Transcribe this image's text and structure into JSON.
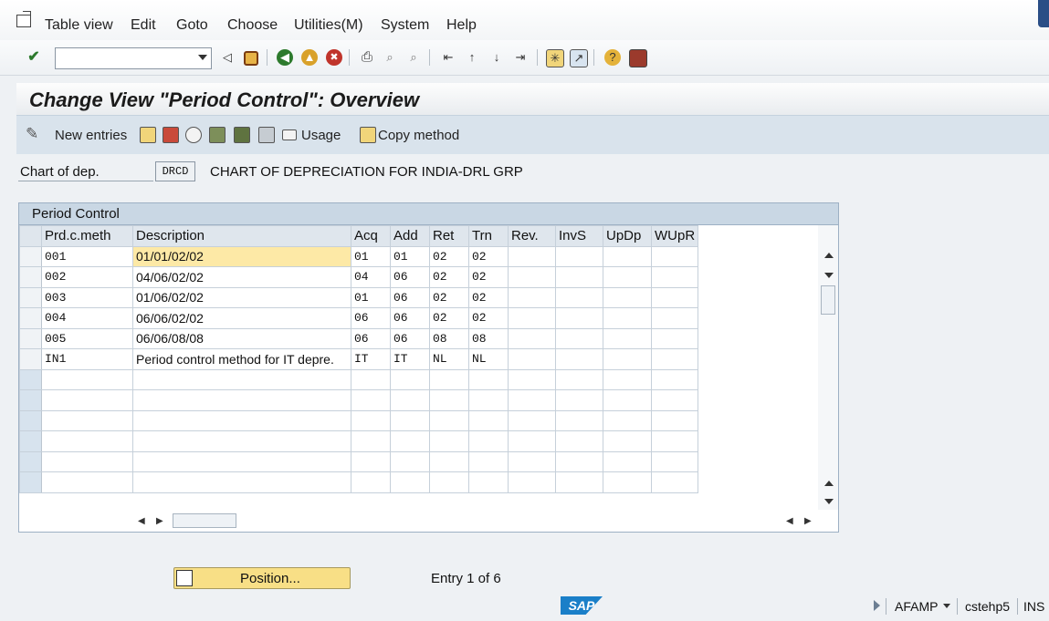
{
  "menu": {
    "items": [
      "Table view",
      "Edit",
      "Goto",
      "Choose",
      "Utilities(M)",
      "System",
      "Help"
    ]
  },
  "toolbar": {
    "icons": [
      "enter-icon",
      "back-icon",
      "save-icon",
      "back-green-icon",
      "exit-icon",
      "cancel-icon",
      "print-icon",
      "find-icon",
      "find-next-icon",
      "first-page-icon",
      "prev-page-icon",
      "next-page-icon",
      "last-page-icon",
      "create-session-icon",
      "shortcut-icon",
      "help-icon",
      "layout-icon"
    ]
  },
  "header": {
    "title": "Change View \"Period Control\": Overview"
  },
  "appbar": {
    "new_entries": "New entries",
    "usage": "Usage",
    "copy_method": "Copy method"
  },
  "chart": {
    "label": "Chart of dep.",
    "code": "DRCD",
    "description": "CHART OF DEPRECIATION FOR INDIA-DRL GRP"
  },
  "table": {
    "title": "Period Control",
    "columns": [
      "Prd.c.meth",
      "Description",
      "Acq",
      "Add",
      "Ret",
      "Trn",
      "Rev.",
      "InvS",
      "UpDp",
      "WUpR"
    ],
    "rows": [
      [
        "001",
        "01/01/02/02",
        "01",
        "01",
        "02",
        "02",
        "",
        "",
        "",
        ""
      ],
      [
        "002",
        "04/06/02/02",
        "04",
        "06",
        "02",
        "02",
        "",
        "",
        "",
        ""
      ],
      [
        "003",
        "01/06/02/02",
        "01",
        "06",
        "02",
        "02",
        "",
        "",
        "",
        ""
      ],
      [
        "004",
        "06/06/02/02",
        "06",
        "06",
        "02",
        "02",
        "",
        "",
        "",
        ""
      ],
      [
        "005",
        "06/06/08/08",
        "06",
        "06",
        "08",
        "08",
        "",
        "",
        "",
        ""
      ],
      [
        "IN1",
        "Period control method for IT depre.",
        "IT",
        "IT",
        "NL",
        "NL",
        "",
        "",
        "",
        ""
      ]
    ]
  },
  "footer": {
    "position_button": "Position...",
    "entry_info": "Entry 1 of 6"
  },
  "status": {
    "transaction": "AFAMP",
    "server": "cstehp5",
    "mode": "INS"
  },
  "colors": {
    "position_button": "#f8df86",
    "focus_cell": "#fde9a6",
    "appbar": "#d9e3ec"
  }
}
